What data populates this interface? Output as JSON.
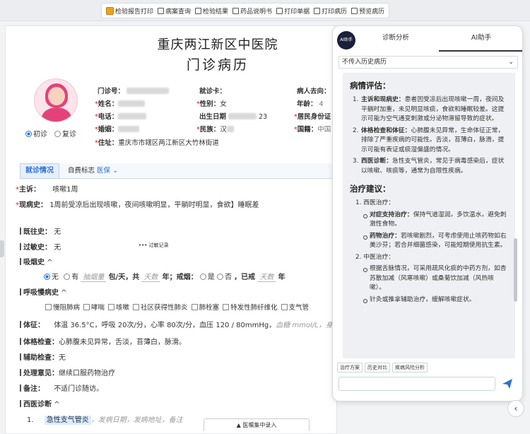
{
  "toolbar": {
    "items": [
      {
        "label": "检验报告打印",
        "icon": "package-icon"
      },
      {
        "label": "病案查询",
        "icon": "document-icon"
      },
      {
        "label": "检验结果",
        "icon": "document-icon"
      },
      {
        "label": "药品说明书",
        "icon": "document-icon"
      },
      {
        "label": "打印单据",
        "icon": "printer-icon"
      },
      {
        "label": "打印病历",
        "icon": "printer-icon"
      },
      {
        "label": "预览病历",
        "icon": "preview-icon"
      }
    ]
  },
  "record": {
    "hospital": "重庆两江新区中医院",
    "title": "门诊病历",
    "visit_first": "初诊",
    "visit_return": "复诊",
    "clinic_no_label": "门诊号：",
    "name_label": "姓名：",
    "phone_label": "电话：",
    "marriage_label": "婚姻：",
    "address_label": "住址：",
    "address_value": "重庆市市辖区两江新区大竹林街道",
    "card_label": "就诊卡：",
    "gender_label": "性别：",
    "gender_value": "女",
    "dob_label": "出生日期",
    "dob_partial": "23",
    "ethnicity_label": "民族：",
    "ethnicity_value": "汉",
    "dest_label": "病人去向：",
    "age_label": "年龄：",
    "age_partial": "4",
    "id_label": "居民身份证",
    "nation_label": "国籍：",
    "nation_partial": "中国"
  },
  "tabs": {
    "visit_info": "就诊情况",
    "self_pay_label": "自费标志",
    "self_pay_value": "医保"
  },
  "fields": {
    "chief_label": "主诉：",
    "chief_value": "咳嗽1周",
    "hpi_label": "现病史：",
    "hpi_value": "1周前受凉后出现咳嗽，夜间咳嗽明显，平躺时明显，食欲】睡眠差",
    "past_label": "既往史：",
    "past_value": "无",
    "allergy_label": "过敏史：",
    "allergy_value": "无",
    "allergy_btn": "••• 过敏记录",
    "smoke_label": "吸烟史",
    "smoke_no": "无",
    "smoke_yes": "有",
    "smoke_pack_ph": "抽烟量",
    "smoke_unit": "包/天，共",
    "smoke_years_ph": "天数",
    "smoke_quit_label": "年；戒烟：",
    "smoke_quit_yes": "是",
    "smoke_quit_no": "否",
    "smoke_quit_years_prefix": "，已戒",
    "smoke_quit_years_ph": "天数",
    "smoke_quit_years_suffix": "年",
    "copd_label": "呼吸慢病史",
    "copd_options": [
      "慢阻肺病",
      "哮喘",
      "咳嗽",
      "社区获得性肺炎",
      "肺栓塞",
      "特发性肺纤维化",
      "支气管"
    ],
    "vitals_label": "体征：",
    "vitals_value": "体温 36.5°C，呼吸 20次/分，心率 80次/分，血压 120 / 80mmHg，",
    "vitals_hint": "血糖 mmol/L，身高",
    "exam_label": "体格检查：",
    "exam_value": "心肺腹未见异常，舌淡，苔薄白，脉滑。",
    "aux_label": "辅助检查：",
    "aux_value": "无",
    "plan_label": "处理意见：",
    "plan_value": "继续口服药物治疗",
    "note_label": "备注：",
    "note_value": "不适门诊随访。",
    "wm_dx_label": "西医诊断",
    "wm_dx_num": "1.",
    "wm_dx_value": "急性支气管炎",
    "wm_dx_hint": "，发病日期，发病地址，备注",
    "bottom_btn": "▲ 医嘱集中录入"
  },
  "panel": {
    "logo": "AI助手",
    "tab_analysis": "诊断分析",
    "tab_ai": "AI助手",
    "select_value": "不传入历史病历",
    "assessment_title": "病情评估：",
    "assessment": [
      {
        "num": "1.",
        "head": "主诉和现病史：",
        "text": "患者因受凉后出现咳嗽一周，夜间及平躺时加重，未见明显咳痰，食欲和睡眠较差。这提示可能为空气通变刺激或分泌物滞留导致的症状。"
      },
      {
        "num": "2.",
        "head": "体格检查和体征：",
        "text": "心肺腹未见异常，生命体征正常，排除了严重疾病的可能性。舌淡，苔薄白，脉滑，提示可能有表证或痰湿偏盛的情况。"
      },
      {
        "num": "3.",
        "head": "西医诊断：",
        "text": "急性支气管炎，常见于病毒感染后，症状以咳嗽、咳痰等，通常为自限性疾病。"
      }
    ],
    "treatment_title": "治疗建议：",
    "wm_head": "1. 西医治疗：",
    "wm_items": [
      {
        "head": "对症支持治疗：",
        "text": "保持气道湿润，多饮温水，避免刺激性食物。"
      },
      {
        "head": "药物治疗：",
        "text": "若咳嗽剧烈，可考虑使用止咳药物如右美沙芬；若合并细菌感染，可能短期使用抗生素。"
      }
    ],
    "tcm_head": "2. 中医治疗：",
    "tcm_items": [
      {
        "head": "",
        "text": "根据舌脉情况，可采用疏风化痰的中药方剂，如杏苏散加减（风寒咳嗽）或桑菊饮加减（风热咳嗽）。"
      },
      {
        "head": "",
        "text": "针灸或推拿辅助治疗，缓解咳嗽症状。"
      }
    ],
    "chips": [
      "治疗方案",
      "历史对比",
      "疾病风险分析"
    ],
    "input_placeholder": ""
  }
}
